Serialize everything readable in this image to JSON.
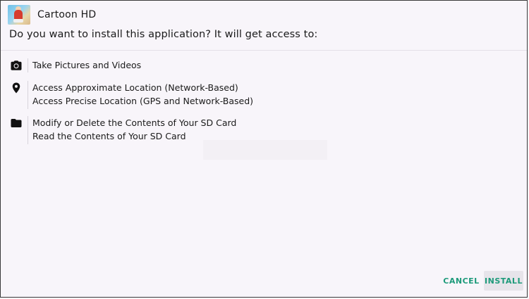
{
  "app": {
    "title": "Cartoon HD",
    "icon": "cartoon-hd-app-icon"
  },
  "prompt": "Do you want to install this application? It will get access to:",
  "permissions": [
    {
      "icon": "camera-icon",
      "lines": [
        "Take Pictures and Videos"
      ]
    },
    {
      "icon": "location-pin-icon",
      "lines": [
        "Access Approximate Location (Network-Based)",
        "Access Precise Location (GPS and Network-Based)"
      ]
    },
    {
      "icon": "folder-icon",
      "lines": [
        "Modify or Delete the Contents of Your SD Card",
        "Read the Contents of Your SD Card"
      ]
    }
  ],
  "buttons": {
    "cancel": "CANCEL",
    "install": "INSTALL"
  },
  "colors": {
    "background": "#f8f5fa",
    "accent": "#1d9a7a",
    "install_button_bg": "#e7e4ea"
  }
}
